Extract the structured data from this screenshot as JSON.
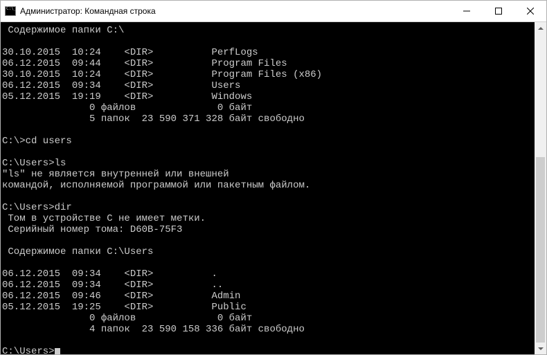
{
  "titlebar": {
    "title": "Администратор: Командная строка"
  },
  "terminal": {
    "header1": " Содержимое папки C:\\",
    "listing1": [
      {
        "date": "30.10.2015",
        "time": "10:24",
        "type": "<DIR>",
        "name": "PerfLogs"
      },
      {
        "date": "06.12.2015",
        "time": "09:44",
        "type": "<DIR>",
        "name": "Program Files"
      },
      {
        "date": "30.10.2015",
        "time": "10:24",
        "type": "<DIR>",
        "name": "Program Files (x86)"
      },
      {
        "date": "06.12.2015",
        "time": "09:34",
        "type": "<DIR>",
        "name": "Users"
      },
      {
        "date": "05.12.2015",
        "time": "19:19",
        "type": "<DIR>",
        "name": "Windows"
      }
    ],
    "summary1a": "               0 файлов              0 байт",
    "summary1b": "               5 папок  23 590 371 328 байт свободно",
    "prompt1": "C:\\>cd users",
    "prompt2": "C:\\Users>ls",
    "error1": "\"ls\" не является внутренней или внешней",
    "error2": "командой, исполняемой программой или пакетным файлом.",
    "prompt3": "C:\\Users>dir",
    "volinfo1": " Том в устройстве C не имеет метки.",
    "volinfo2": " Серийный номер тома: D60B-75F3",
    "header2": " Содержимое папки C:\\Users",
    "listing2": [
      {
        "date": "06.12.2015",
        "time": "09:34",
        "type": "<DIR>",
        "name": "."
      },
      {
        "date": "06.12.2015",
        "time": "09:34",
        "type": "<DIR>",
        "name": ".."
      },
      {
        "date": "06.12.2015",
        "time": "09:46",
        "type": "<DIR>",
        "name": "Admin"
      },
      {
        "date": "05.12.2015",
        "time": "19:25",
        "type": "<DIR>",
        "name": "Public"
      }
    ],
    "summary2a": "               0 файлов              0 байт",
    "summary2b": "               4 папок  23 590 158 336 байт свободно",
    "prompt4": "C:\\Users>"
  },
  "scrollbar": {
    "thumb_top_pct": 40,
    "thumb_height_pct": 60
  }
}
